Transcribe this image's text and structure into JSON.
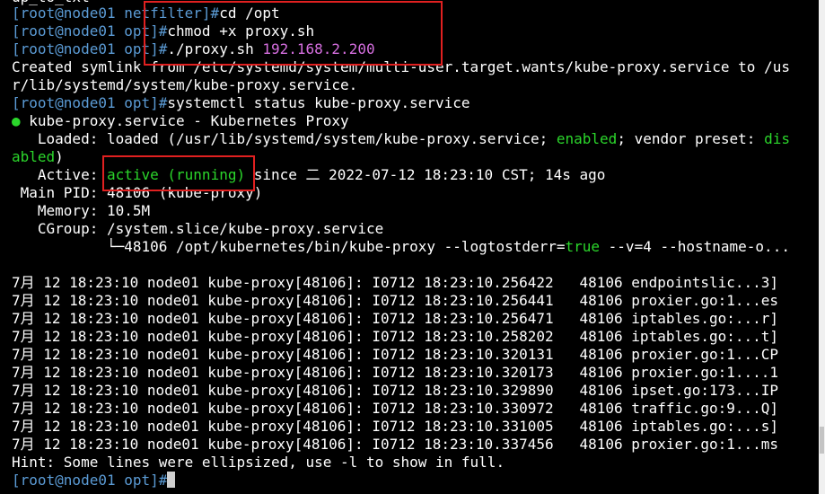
{
  "top_fragment": "up_to_txt",
  "prompts": {
    "netfilter": "[root@node01 netfilter]#",
    "opt": "[root@node01 opt]#"
  },
  "commands": {
    "cd": "cd /opt",
    "chmod": "chmod +x proxy.sh",
    "run_script": "./proxy.sh ",
    "run_ip": "192.168.2.200",
    "status": "systemctl status kube-proxy.service"
  },
  "output": {
    "symlink_1": "Created symlink from /etc/systemd/system/multi-user.target.wants/kube-proxy.service to /us",
    "symlink_2": "r/lib/systemd/system/kube-proxy.service.",
    "service_dot": "●",
    "service_title": " kube-proxy.service - Kubernetes Proxy",
    "loaded_pre": "   Loaded: loaded (/usr/lib/systemd/system/kube-proxy.service; ",
    "loaded_enabled": "enabled",
    "loaded_mid": "; vendor preset: ",
    "loaded_dis": "dis",
    "loaded_cont": "abled",
    "loaded_close": ")",
    "active_label": "   Active: ",
    "active_value": "active (running)",
    "active_since": " since 二 2022-07-12 18:23:10 CST; 14s ago",
    "main_pid": " Main PID: 48106 (kube-proxy)",
    "memory": "   Memory: 10.5M",
    "cgroup": "   CGroup: /system.slice/kube-proxy.service",
    "cgroup_proc_pre": "           └─48106 /opt/kubernetes/bin/kube-proxy --logtostderr=",
    "cgroup_proc_true": "true",
    "cgroup_proc_post": " --v=4 --hostname-o...",
    "hint": "Hint: Some lines were ellipsized, use -l to show in full."
  },
  "log_lines": [
    "7月 12 18:23:10 node01 kube-proxy[48106]: I0712 18:23:10.256422   48106 endpointslic...3]",
    "7月 12 18:23:10 node01 kube-proxy[48106]: I0712 18:23:10.256441   48106 proxier.go:1...es",
    "7月 12 18:23:10 node01 kube-proxy[48106]: I0712 18:23:10.256471   48106 iptables.go:...r]",
    "7月 12 18:23:10 node01 kube-proxy[48106]: I0712 18:23:10.258202   48106 iptables.go:...t]",
    "7月 12 18:23:10 node01 kube-proxy[48106]: I0712 18:23:10.320131   48106 proxier.go:1...CP",
    "7月 12 18:23:10 node01 kube-proxy[48106]: I0712 18:23:10.320173   48106 proxier.go:1....1",
    "7月 12 18:23:10 node01 kube-proxy[48106]: I0712 18:23:10.329890   48106 ipset.go:173...IP",
    "7月 12 18:23:10 node01 kube-proxy[48106]: I0712 18:23:10.330972   48106 traffic.go:9...Q]",
    "7月 12 18:23:10 node01 kube-proxy[48106]: I0712 18:23:10.331005   48106 iptables.go:...s]",
    "7月 12 18:23:10 node01 kube-proxy[48106]: I0712 18:23:10.337456   48106 proxier.go:1...ms"
  ],
  "colors": {
    "background": "#000000",
    "prompt": "#5b9bd5",
    "ip_highlight": "#d66fe0",
    "status_green": "#2bd62b",
    "annotation_box": "#e02020"
  }
}
